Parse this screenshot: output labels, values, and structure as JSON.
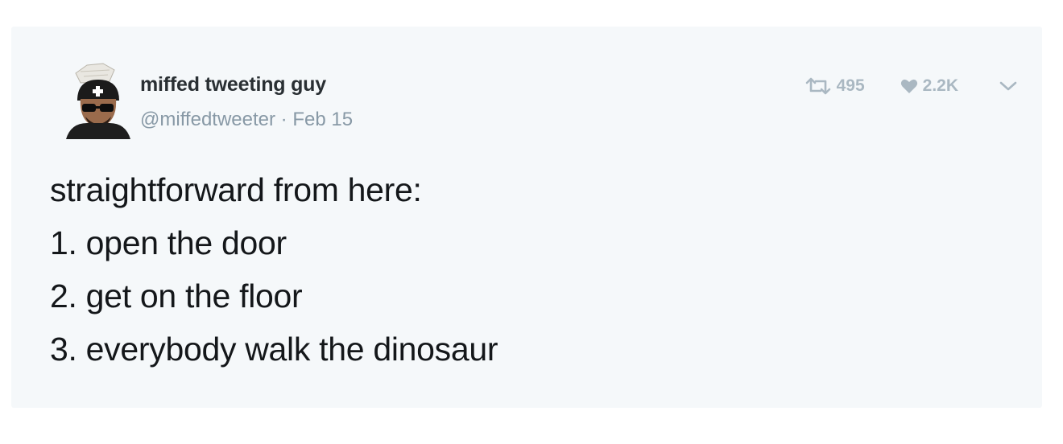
{
  "tweet": {
    "author": {
      "display_name": "miffed tweeting guy",
      "handle": "@miffedtweeter",
      "avatar_icon": "avatar-icon"
    },
    "separator": "·",
    "date": "Feb 15",
    "lines": [
      "straightforward from here:",
      "1. open the door",
      "2. get on the floor",
      "3. everybody walk the dinosaur"
    ],
    "stats": {
      "retweets": "495",
      "likes": "2.2K"
    },
    "icons": {
      "retweet": "retweet-icon",
      "like": "heart-icon",
      "menu": "chevron-down-icon"
    },
    "colors": {
      "card_background": "#f5f8fa",
      "text": "#14171a",
      "muted": "#8899a6",
      "icon": "#aab8c2"
    }
  }
}
